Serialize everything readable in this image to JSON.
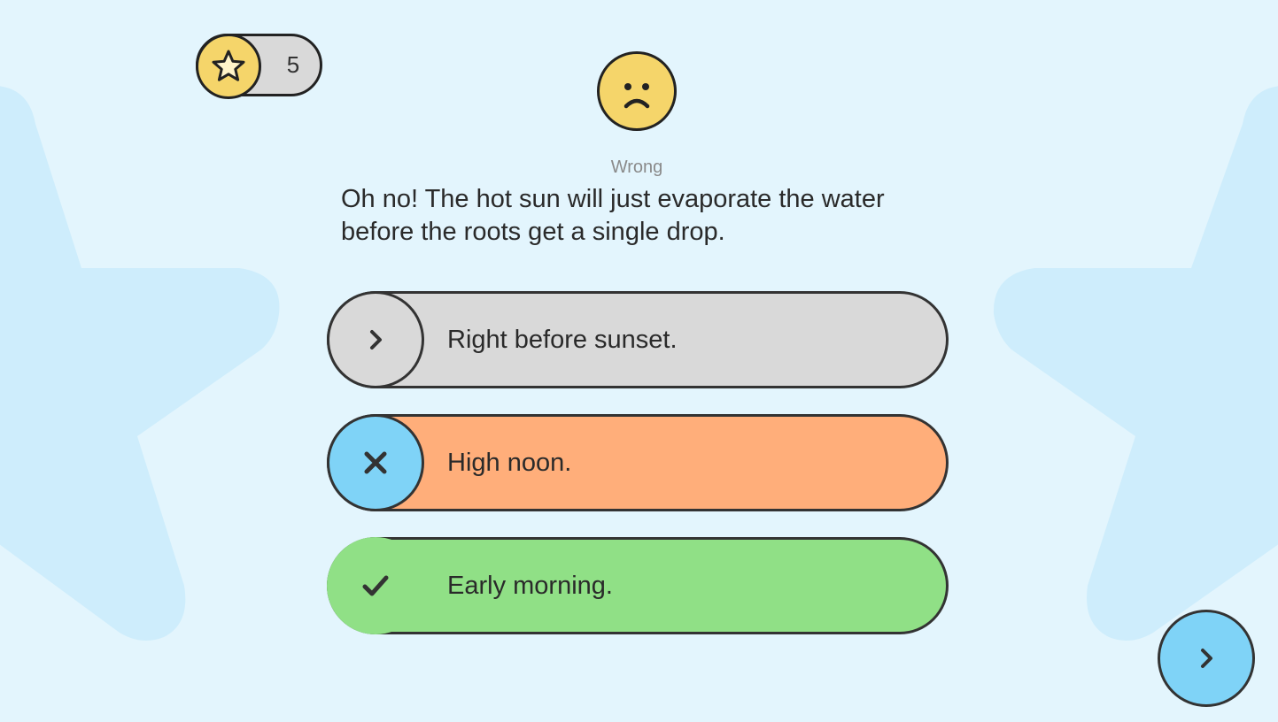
{
  "colors": {
    "background": "#e3f5fd",
    "background_star": "#ceedfc",
    "score_star": "#f5d56a",
    "face": "#f5d56a",
    "option_neutral": "#d9d9d9",
    "option_wrong": "#ffae7a",
    "option_correct": "#90e086",
    "accent_blue": "#7fd3f7"
  },
  "score": {
    "icon": "star-icon",
    "value": "5"
  },
  "result": {
    "icon": "sad-face-icon",
    "label": "Wrong",
    "feedback": "Oh no! The hot sun will just evaporate the water before the roots get a single drop."
  },
  "options": [
    {
      "text": "Right before sunset.",
      "state": "unselected",
      "icon": "chevron-right-icon"
    },
    {
      "text": "High noon.",
      "state": "selected-wrong",
      "icon": "close-icon"
    },
    {
      "text": "Early morning.",
      "state": "correct",
      "icon": "checkmark-icon"
    }
  ],
  "next": {
    "icon": "chevron-right-icon"
  }
}
